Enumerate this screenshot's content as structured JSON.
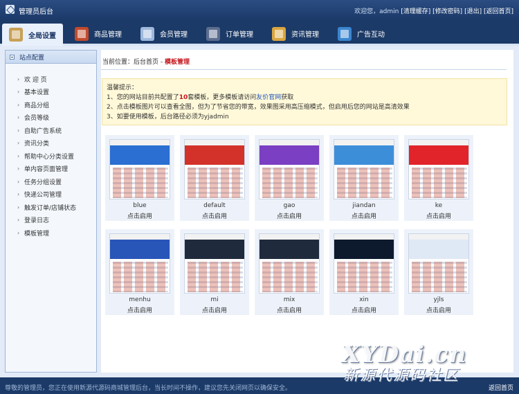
{
  "app": {
    "title": "管理员后台"
  },
  "topbar": {
    "welcome": "欢迎您，admin",
    "links": [
      "[清理缓存]",
      "[修改密码]",
      "[退出]",
      "[返回首页]"
    ]
  },
  "nav": [
    {
      "label": "全局设置",
      "icon": "globe-settings-icon",
      "active": true
    },
    {
      "label": "商品管理",
      "icon": "goods-icon"
    },
    {
      "label": "会员管理",
      "icon": "member-icon"
    },
    {
      "label": "订单管理",
      "icon": "order-icon"
    },
    {
      "label": "资讯管理",
      "icon": "news-icon"
    },
    {
      "label": "广告互动",
      "icon": "ad-icon"
    }
  ],
  "sidebar": {
    "title": "站点配置",
    "items": [
      "欢 迎 页",
      "基本设置",
      "商品分组",
      "会员等级",
      "自助广告系统",
      "资讯分类",
      "帮助中心分类设置",
      "单内容页面管理",
      "任务分组设置",
      "快递公司管理",
      "触发订单/店铺状态",
      "登录日志",
      "模板管理"
    ]
  },
  "breadcrumb": {
    "prefix": "当前位置：后台首页 - ",
    "current": "模板管理"
  },
  "tips": {
    "title": "温馨提示：",
    "line1_a": "1、您的网站目前共配置了",
    "line1_num": "10",
    "line1_b": "套模板，更多模板请访问",
    "line1_link": "友价官网",
    "line1_c": "获取",
    "line2": "2、点击模板图片可以查看全图，但为了节省您的带宽，效果图采用高压缩模式，但启用后您的网站是高清效果",
    "line3": "3、如要使用模板，后台路径必须为yjadmin"
  },
  "templates": [
    {
      "name": "blue",
      "action": "点击启用",
      "banner": "#2a6fd1"
    },
    {
      "name": "default",
      "action": "点击启用",
      "banner": "#d2322a"
    },
    {
      "name": "gao",
      "action": "点击启用",
      "banner": "#7a3fc2"
    },
    {
      "name": "jiandan",
      "action": "点击启用",
      "banner": "#3d8ed9"
    },
    {
      "name": "ke",
      "action": "点击启用",
      "banner": "#e0242a"
    },
    {
      "name": "menhu",
      "action": "点击启用",
      "banner": "#2856b8"
    },
    {
      "name": "mi",
      "action": "点击启用",
      "banner": "#1f2a3d"
    },
    {
      "name": "mix",
      "action": "点击启用",
      "banner": "#1f2a3d"
    },
    {
      "name": "xin",
      "action": "点击启用",
      "banner": "#0d1a2e"
    },
    {
      "name": "yjls",
      "action": "点击启用",
      "banner": "#dfe9f5"
    }
  ],
  "footer": {
    "message": "尊敬的管理员，您正在使用新源代源码商城管理后台，当长时间不操作，建议您先关闭网页以确保安全。",
    "link": "返回首页"
  },
  "watermark": {
    "line1": "XYDai.cn",
    "line2": "新源代源码社区"
  }
}
